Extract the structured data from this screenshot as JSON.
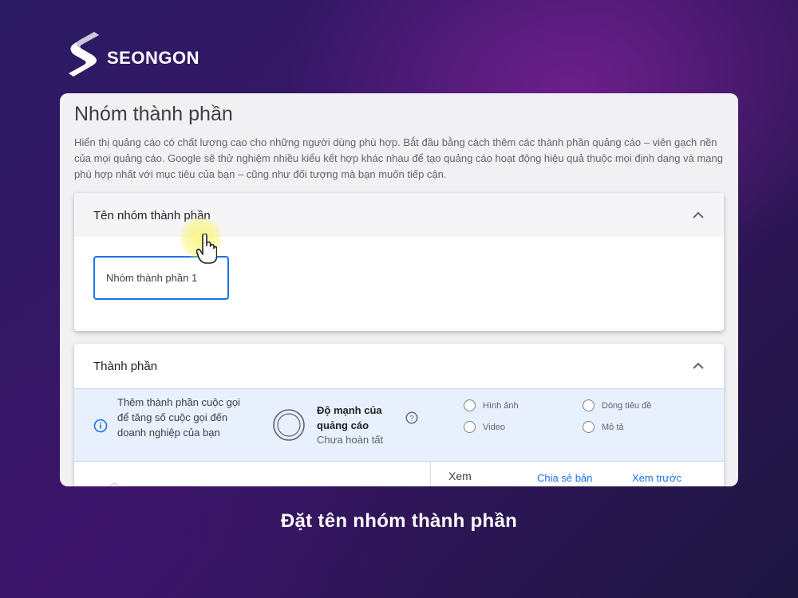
{
  "brand": {
    "name": "SEONGON"
  },
  "page": {
    "title": "Nhóm thành phần",
    "description": "Hiển thị quảng cáo có chất lượng cao cho những người dùng phù hợp. Bắt đầu bằng cách thêm các thành phần quảng cáo – viên gạch nền của mọi quảng cáo. Google sẽ thử nghiệm nhiều kiểu kết hợp khác nhau để tạo quảng cáo hoạt động hiệu quả thuộc mọi định dạng và mạng phù hợp nhất với mục tiêu của bạn – cũng như đối tượng mà bạn muốn tiếp cận."
  },
  "name_panel": {
    "title": "Tên nhóm thành phần",
    "input_value": "Nhóm thành phần 1"
  },
  "assets_panel": {
    "title": "Thành phần",
    "info_text": "Thêm thành phần cuộc gọi để tăng số cuộc gọi đến doanh nghiệp của bạn",
    "strength_title": "Độ mạnh của quảng cáo",
    "strength_status": "Chưa hoàn tất",
    "checklist": [
      "Hình ảnh",
      "Dòng tiêu đề",
      "Video",
      "Mô tả"
    ],
    "bottom": {
      "xem": "Xem",
      "share": "Chia sẻ bản",
      "preview": "Xem trước"
    }
  },
  "caption": "Đặt tên nhóm thành phần",
  "colors": {
    "accent": "#1a73e8",
    "info_bg": "#e8f0fe",
    "highlight": "#faf578"
  }
}
